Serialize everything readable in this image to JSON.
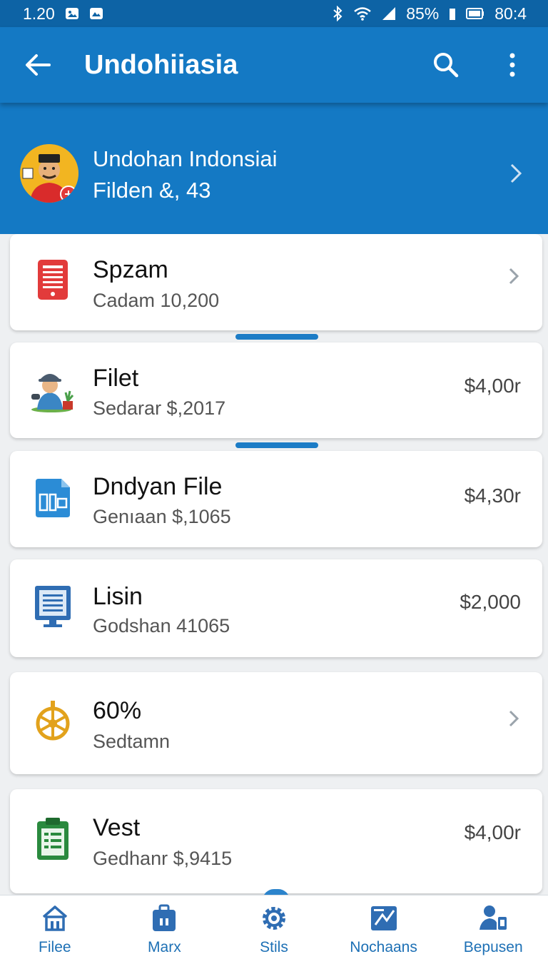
{
  "status_bar": {
    "time": "1.20",
    "battery_percent": "85%",
    "clock": "80:4"
  },
  "app_bar": {
    "title": "Undohiiasia",
    "back_icon": "arrow-left-icon",
    "search_icon": "search-icon",
    "more_icon": "more-vertical-icon"
  },
  "profile": {
    "name": "Undohan Indonsiai",
    "subtitle": "Filden &, 43"
  },
  "items": [
    {
      "title": "Spzam",
      "subtitle": "Cadam 10,200",
      "amount": "",
      "icon": "document-red-icon",
      "chevron": true
    },
    {
      "title": "Filet",
      "subtitle": "Sedarar $,2017",
      "amount": "$4,00r",
      "icon": "person-illustration-icon",
      "chevron": false
    },
    {
      "title": "Dndyan File",
      "subtitle": "Genıaan $,1065",
      "amount": "$4,30r",
      "icon": "file-blue-icon",
      "chevron": false
    },
    {
      "title": "Lisin",
      "subtitle": "Godshan 41065",
      "amount": "$2,000",
      "icon": "monitor-icon",
      "chevron": false
    },
    {
      "title": "60%",
      "subtitle": "Sedtamn",
      "amount": "",
      "icon": "wheel-orange-icon",
      "chevron": true
    },
    {
      "title": "Vest",
      "subtitle": "Gedhanr $,9415",
      "amount": "$4,00r",
      "icon": "clipboard-green-icon",
      "chevron": false
    }
  ],
  "bottom_nav": [
    {
      "label": "Filee",
      "icon": "home-icon"
    },
    {
      "label": "Marx",
      "icon": "briefcase-icon"
    },
    {
      "label": "Stils",
      "icon": "gear-icon"
    },
    {
      "label": "Nochaans",
      "icon": "chart-icon"
    },
    {
      "label": "Bepusen",
      "icon": "user-device-icon"
    }
  ],
  "colors": {
    "status_bar": "#0d63a5",
    "app_bar": "#1479c4",
    "accent": "#1d70b5"
  }
}
